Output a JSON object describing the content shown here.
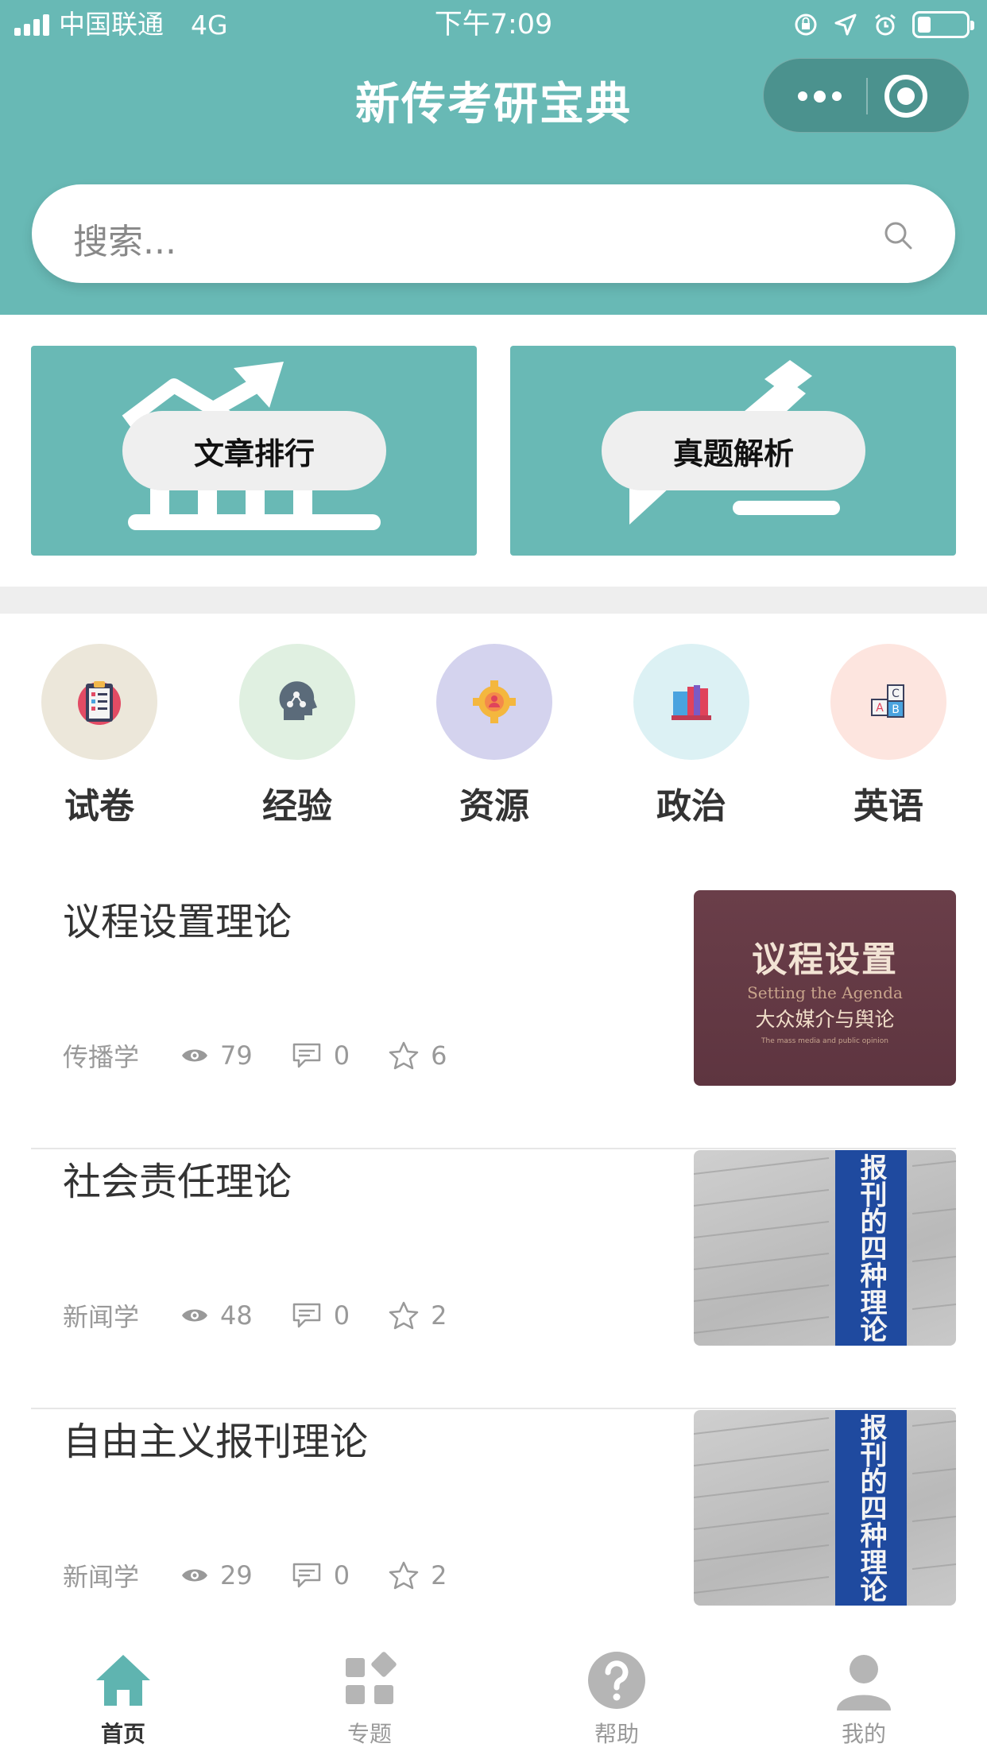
{
  "status_bar": {
    "carrier": "中国联通",
    "network": "4G",
    "time": "下午7:09"
  },
  "nav": {
    "title": "新传考研宝典"
  },
  "search": {
    "placeholder": "搜索..."
  },
  "banners": [
    {
      "label": "文章排行",
      "icon": "bar-chart-trend-icon"
    },
    {
      "label": "真题解析",
      "icon": "pencil-icon"
    }
  ],
  "categories": [
    {
      "label": "试卷",
      "icon": "clipboard-checklist-icon",
      "bg": "#ece7da"
    },
    {
      "label": "经验",
      "icon": "head-brain-icon",
      "bg": "#e0f0e1"
    },
    {
      "label": "资源",
      "icon": "gear-person-icon",
      "bg": "#d4d3ee"
    },
    {
      "label": "政治",
      "icon": "books-icon",
      "bg": "#dcf1f4"
    },
    {
      "label": "英语",
      "icon": "abc-blocks-icon",
      "bg": "#fde5df"
    }
  ],
  "articles": [
    {
      "title": "议程设置理论",
      "category": "传播学",
      "views": "79",
      "comments": "0",
      "stars": "6",
      "thumb": {
        "title": "议程设置",
        "subtitle_en": "Setting the Agenda",
        "subtitle": "大众媒介与舆论",
        "tagline": "The mass media and public opinion"
      }
    },
    {
      "title": "社会责任理论",
      "category": "新闻学",
      "views": "48",
      "comments": "0",
      "stars": "2",
      "thumb": {
        "spine": "报刊的四种理论"
      }
    },
    {
      "title": "自由主义报刊理论",
      "category": "新闻学",
      "views": "29",
      "comments": "0",
      "stars": "2",
      "thumb": {
        "spine": "报刊的四种理论"
      }
    }
  ],
  "tabbar": [
    {
      "label": "首页",
      "icon": "home-icon",
      "active": true
    },
    {
      "label": "专题",
      "icon": "grid-icon",
      "active": false
    },
    {
      "label": "帮助",
      "icon": "question-icon",
      "active": false
    },
    {
      "label": "我的",
      "icon": "user-icon",
      "active": false
    }
  ],
  "colors": {
    "brand": "#68b9b5",
    "tab_active": "#5fb4b0",
    "tab_inactive": "#b5b5b5"
  }
}
